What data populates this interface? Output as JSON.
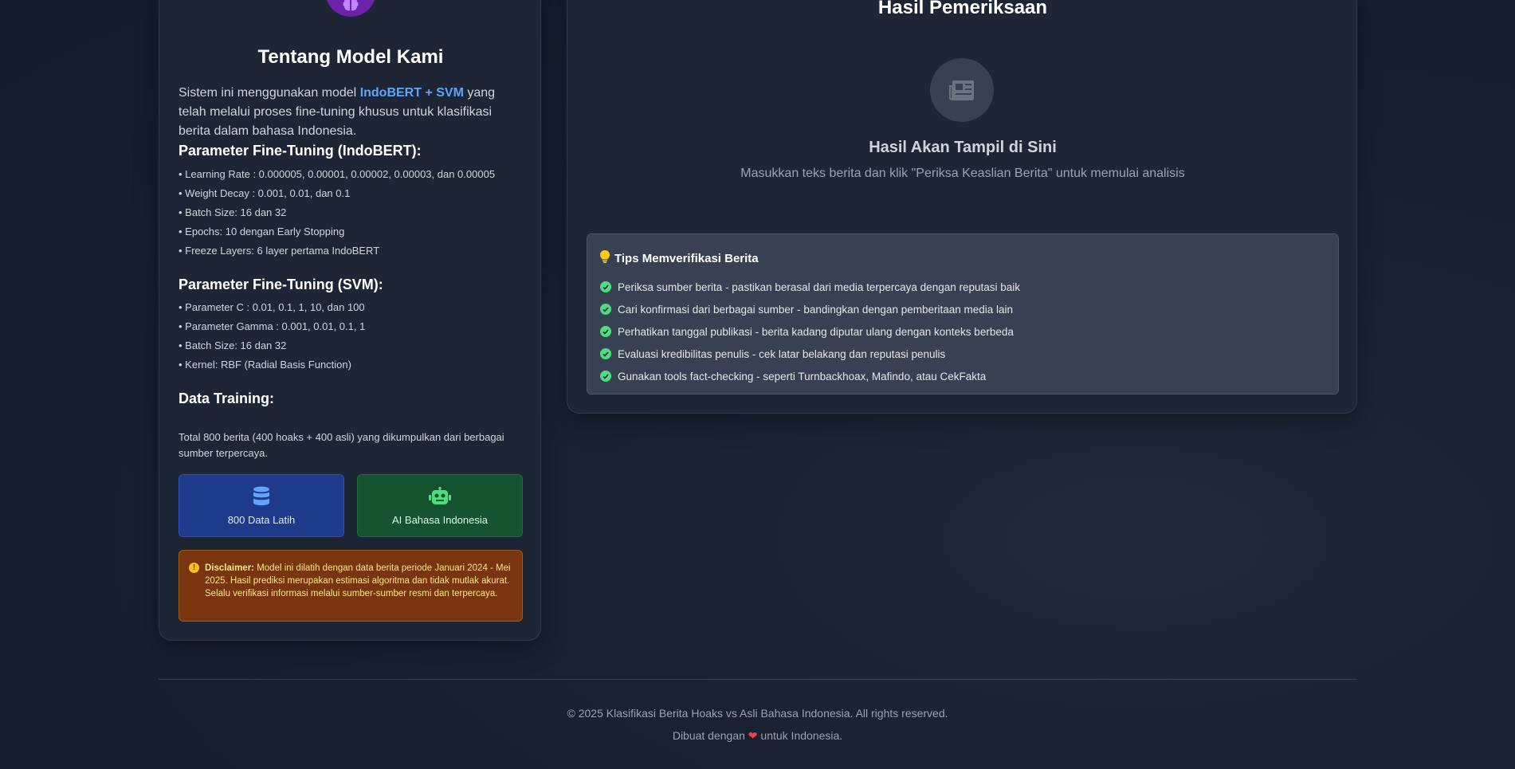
{
  "left": {
    "title": "Tentang Model Kami",
    "intro_before": "Sistem ini menggunakan model ",
    "intro_highlight": "IndoBERT + SVM",
    "intro_after": " yang telah melalui proses fine-tuning khusus untuk klasifikasi berita dalam bahasa Indonesia.",
    "indobert_title": "Parameter Fine-Tuning (IndoBERT):",
    "indobert_params": [
      "• Learning Rate : 0.000005, 0.00001, 0.00002, 0.00003, dan 0.00005",
      "• Weight Decay : 0.001, 0.01, dan 0.1",
      "• Batch Size: 16 dan 32",
      "• Epochs: 10 dengan Early Stopping",
      "• Freeze Layers: 6 layer pertama IndoBERT"
    ],
    "svm_title": "Parameter Fine-Tuning (SVM):",
    "svm_params": [
      "• Parameter C : 0.01, 0.1, 1, 10, dan 100",
      "• Parameter Gamma : 0.001, 0.01, 0.1, 1",
      "• Batch Size: 16 dan 32",
      "• Kernel: RBF (Radial Basis Function)"
    ],
    "training_title": "Data Training:",
    "training_text": "Total 800 berita (400 hoaks + 400 asli) yang dikumpulkan dari berbagai sumber terpercaya.",
    "stat_data": "800 Data Latih",
    "stat_ai": "AI Bahasa Indonesia",
    "disclaimer_label": "Disclaimer:",
    "disclaimer_text": " Model ini dilatih dengan data berita periode Januari 2024 - Mei 2025. Hasil prediksi merupakan estimasi algoritma dan tidak mutlak akurat. Selalu verifikasi informasi melalui sumber-sumber resmi dan terpercaya."
  },
  "right": {
    "title": "Hasil Pemeriksaan",
    "result_heading": "Hasil Akan Tampil di Sini",
    "result_sub": "Masukkan teks berita dan klik \"Periksa Keaslian Berita\" untuk memulai analisis",
    "tips_title": "Tips Memverifikasi Berita",
    "tips": [
      "Periksa sumber berita - pastikan berasal dari media terpercaya dengan reputasi baik",
      "Cari konfirmasi dari berbagai sumber - bandingkan dengan pemberitaan media lain",
      "Perhatikan tanggal publikasi - berita kadang diputar ulang dengan konteks berbeda",
      "Evaluasi kredibilitas penulis - cek latar belakang dan reputasi penulis",
      "Gunakan tools fact-checking - seperti Turnbackhoax, Mafindo, atau CekFakta"
    ]
  },
  "footer": {
    "copyright": "© 2025 Klasifikasi Berita Hoaks vs Asli Bahasa Indonesia. All rights reserved.",
    "made_before": "Dibuat dengan ",
    "made_heart": "❤",
    "made_after": " untuk Indonesia."
  },
  "icons": {
    "brain": "brain-icon",
    "database": "database-icon",
    "robot": "robot-icon",
    "newspaper": "newspaper-icon",
    "lightbulb": "lightbulb-icon",
    "check": "check-circle-icon",
    "warning": "exclamation-circle-icon",
    "heart": "heart-icon"
  },
  "colors": {
    "accent_blue": "#60a5fa",
    "brain_purple": "#6b21a8",
    "stat_blue": "#1e3a8a",
    "stat_green": "#14532d",
    "disclaimer_bg": "#78350f",
    "check_green": "#4ade80",
    "heart_red": "#ef4444"
  }
}
